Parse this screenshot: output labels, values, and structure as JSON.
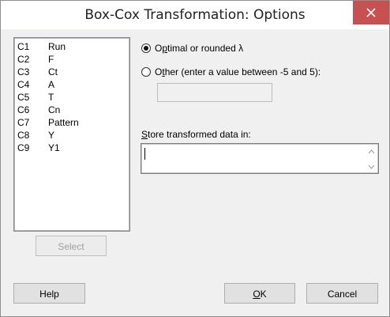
{
  "window": {
    "title": "Box-Cox Transformation: Options"
  },
  "variables": [
    {
      "col": "C1",
      "name": "Run"
    },
    {
      "col": "C2",
      "name": "F"
    },
    {
      "col": "C3",
      "name": "Ct"
    },
    {
      "col": "C4",
      "name": "A"
    },
    {
      "col": "C5",
      "name": "T"
    },
    {
      "col": "C6",
      "name": "Cn"
    },
    {
      "col": "C7",
      "name": "Pattern"
    },
    {
      "col": "C8",
      "name": "Y"
    },
    {
      "col": "C9",
      "name": "Y1"
    }
  ],
  "select_button": "Select",
  "lambda": {
    "optimal_hotkey": "p",
    "optimal_pre": "O",
    "optimal_post": "timal or rounded λ",
    "other_hotkey": "t",
    "other_pre": "O",
    "other_post": "her (enter a value between -5 and 5):",
    "other_value": "",
    "selected": "optimal"
  },
  "store": {
    "hotkey": "S",
    "label_rest": "tore transformed data in:",
    "value": ""
  },
  "buttons": {
    "help": "Help",
    "ok_hotkey": "O",
    "ok_rest": "K",
    "cancel": "Cancel"
  },
  "colors": {
    "close": "#c75050",
    "dialog_bg": "#f0f0f0"
  },
  "icons": {
    "close": "close-x-icon",
    "scroll_up": "arrow-up-icon",
    "scroll_down": "arrow-down-icon"
  }
}
